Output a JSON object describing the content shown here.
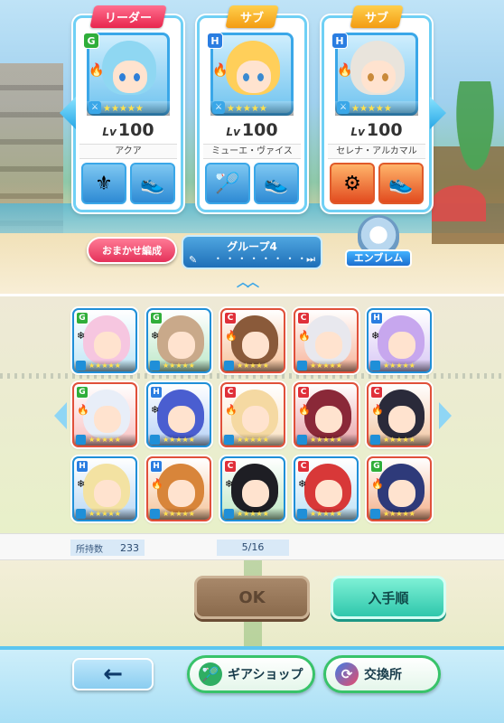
{
  "party": {
    "members": [
      {
        "role": "リーダー",
        "type": "G",
        "level_prefix": "Lv",
        "level": "100",
        "name": "アクア",
        "hair": "#8fd7f2",
        "eyes": "#2f7fd8",
        "stars": "★★★★★",
        "gear1": "⚜",
        "gear2": "👟",
        "gear_red": false
      },
      {
        "role": "サブ",
        "type": "H",
        "level_prefix": "Lv",
        "level": "100",
        "name": "ミューエ・ヴァイス",
        "hair": "#ffcf5a",
        "eyes": "#3a8ad0",
        "stars": "★★★★★",
        "gear1": "🏸",
        "gear2": "👟",
        "gear_red": false
      },
      {
        "role": "サブ",
        "type": "H",
        "level_prefix": "Lv",
        "level": "100",
        "name": "セレナ・アルカマル",
        "hair": "#e9e4dc",
        "eyes": "#c98a3a",
        "stars": "★★★★★",
        "gear1": "⚙",
        "gear2": "👟",
        "gear_red": true
      }
    ]
  },
  "controls": {
    "auto_label": "おまかせ編成",
    "group_name": "グループ4",
    "group_dots": "• • • • • • • •",
    "pencil_icon": "✎",
    "skip_icon": "⏭",
    "up_chevrons": "︿︿",
    "emblem_label": "エンブレム"
  },
  "roster": [
    {
      "type": "G",
      "hair": "#f6c6e0",
      "bg": "#bfe6f7",
      "el": "❄",
      "stars": "★★★★★",
      "red": false
    },
    {
      "type": "G",
      "hair": "#c9a98a",
      "bg": "#bde8c9",
      "el": "❄",
      "stars": "★★★★★",
      "red": false
    },
    {
      "type": "C",
      "hair": "#8a5a3a",
      "bg": "#f7c29a",
      "el": "🔥",
      "stars": "★★★★★",
      "red": true
    },
    {
      "type": "C",
      "hair": "#e8e8ee",
      "bg": "#f7b39a",
      "el": "🔥",
      "stars": "★★★★★",
      "red": true
    },
    {
      "type": "H",
      "hair": "#c7a7ee",
      "bg": "#d8c8f5",
      "el": "❄",
      "stars": "★★★★★",
      "red": false
    },
    {
      "type": "G",
      "hair": "#e8eef8",
      "bg": "#f9c2c2",
      "el": "🔥",
      "stars": "★★★★★",
      "red": true
    },
    {
      "type": "H",
      "hair": "#4a5ed0",
      "bg": "#b7d2f7",
      "el": "❄",
      "stars": "★★★★★",
      "red": false
    },
    {
      "type": "C",
      "hair": "#f5d9a2",
      "bg": "#fbe2c2",
      "el": "🔥",
      "stars": "★★★★★",
      "red": true
    },
    {
      "type": "C",
      "hair": "#8a2838",
      "bg": "#e8a2a8",
      "el": "🔥",
      "stars": "★★★★★",
      "red": true
    },
    {
      "type": "C",
      "hair": "#2a2a3a",
      "bg": "#f2c7a4",
      "el": "🔥",
      "stars": "★★★★★",
      "red": true
    },
    {
      "type": "H",
      "hair": "#f3e2a2",
      "bg": "#b9d8f5",
      "el": "❄",
      "stars": "★★★★★",
      "red": false
    },
    {
      "type": "H",
      "hair": "#d8853a",
      "bg": "#f5c49a",
      "el": "🔥",
      "stars": "★★★★★",
      "red": true
    },
    {
      "type": "C",
      "hair": "#1e1e24",
      "bg": "#bfe8c4",
      "el": "❄",
      "stars": "★★★★★",
      "red": false
    },
    {
      "type": "C",
      "hair": "#d83838",
      "bg": "#bfe3f7",
      "el": "❄",
      "stars": "★★★★★",
      "red": false
    },
    {
      "type": "G",
      "hair": "#2e3a7a",
      "bg": "#f4b08a",
      "el": "🔥",
      "stars": "★★★★★",
      "red": true
    }
  ],
  "stats": {
    "owned_label": "所持数",
    "owned_count": "233",
    "page": "5/16"
  },
  "actions": {
    "ok_label": "OK",
    "order_label": "入手順"
  },
  "footer": {
    "back_icon": "←",
    "gear_shop_label": "ギアショップ",
    "gear_shop_icon": "🏸",
    "exchange_label": "交換所",
    "exchange_icon": "⟳"
  }
}
